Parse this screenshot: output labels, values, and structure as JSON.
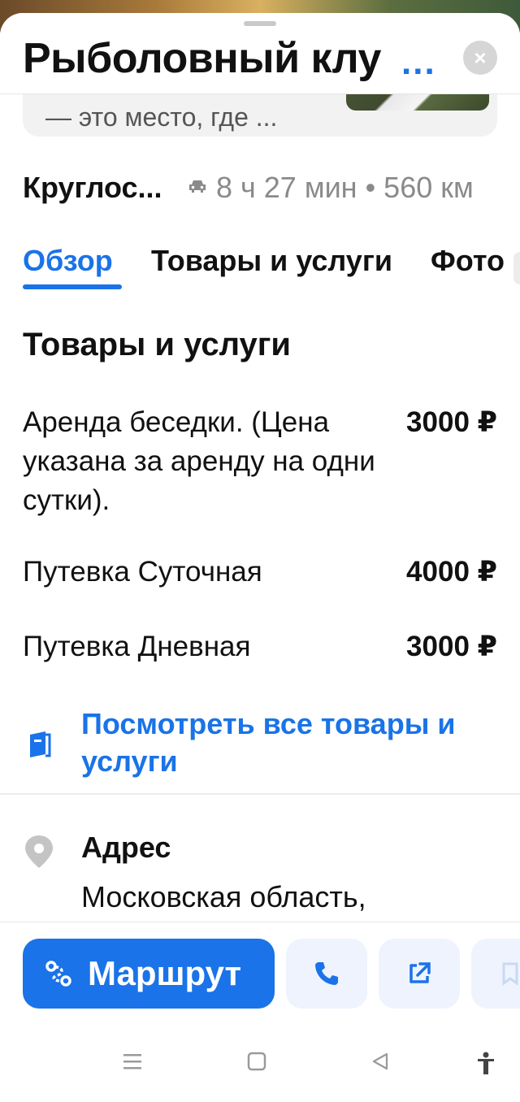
{
  "header": {
    "title": "Рыболовный клу",
    "more_label": "...",
    "close_label": "×"
  },
  "description": {
    "text": "— это место, где ..."
  },
  "info": {
    "hours": "Круглос...",
    "route": "8 ч 27 мин • 560 км"
  },
  "tabs": [
    {
      "label": "Обзор",
      "active": true
    },
    {
      "label": "Товары и услуги",
      "active": false
    },
    {
      "label": "Фото",
      "active": false
    }
  ],
  "services": {
    "title": "Товары и услуги",
    "items": [
      {
        "name": "Аренда беседки. (Цена указана за аренду на одни сутки).",
        "price": "3000 ₽"
      },
      {
        "name": "Путевка Суточная",
        "price": "4000 ₽"
      },
      {
        "name": "Путевка Дневная",
        "price": "3000 ₽"
      }
    ],
    "all_link": "Посмотреть все товары и услуги"
  },
  "address": {
    "label": "Адрес",
    "text": "Московская область, Волоколамский"
  },
  "actions": {
    "route_label": "Маршрут"
  },
  "colors": {
    "accent": "#1a73e8",
    "muted": "#8a8a8a"
  }
}
